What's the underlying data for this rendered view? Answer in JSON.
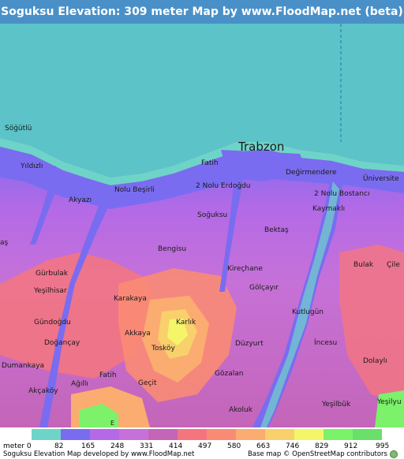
{
  "title": "Soguksu Elevation: 309 meter Map by www.FloodMap.net (beta)",
  "colors": {
    "title_bg": "#4a90c8",
    "sea": "#5cc3c8",
    "shore": "#6fd4c8"
  },
  "place_labels": [
    {
      "id": "sogutlu",
      "text": "Söğütlü"
    },
    {
      "id": "trabzon",
      "text": "Trabzon"
    },
    {
      "id": "fatih-north",
      "text": "Fatih"
    },
    {
      "id": "degirmendere",
      "text": "Değirmendere"
    },
    {
      "id": "yildizli",
      "text": "Yıldızlı"
    },
    {
      "id": "universite",
      "text": "Üniversite"
    },
    {
      "id": "nolu-besirli",
      "text": "Nolu Beşirli"
    },
    {
      "id": "nolu-erdogdu",
      "text": "2 Nolu Erdoğdu"
    },
    {
      "id": "nolu-bostanci",
      "text": "2 Nolu Bostancı"
    },
    {
      "id": "akyazi",
      "text": "Akyazı"
    },
    {
      "id": "kaymakli",
      "text": "Kaymaklı"
    },
    {
      "id": "soguksu",
      "text": "Soğuksu"
    },
    {
      "id": "bektas",
      "text": "Bektaş"
    },
    {
      "id": "as",
      "text": "aş"
    },
    {
      "id": "bengisu",
      "text": "Bengisu"
    },
    {
      "id": "gurbulak",
      "text": "Gürbulak"
    },
    {
      "id": "kirechane",
      "text": "Kireçhane"
    },
    {
      "id": "bulak",
      "text": "Bulak"
    },
    {
      "id": "cile",
      "text": "Çile"
    },
    {
      "id": "yesilhisar",
      "text": "Yeşilhisar"
    },
    {
      "id": "golcayir",
      "text": "Gölçayır"
    },
    {
      "id": "karakaya",
      "text": "Karakaya"
    },
    {
      "id": "kutlugun",
      "text": "Kutlugün"
    },
    {
      "id": "gundogdu",
      "text": "Gündoğdu"
    },
    {
      "id": "karlik",
      "text": "Karlık"
    },
    {
      "id": "akkaya",
      "text": "Akkaya"
    },
    {
      "id": "incesu",
      "text": "İncesu"
    },
    {
      "id": "dogancay",
      "text": "Doğançay"
    },
    {
      "id": "toskoy",
      "text": "Tosköy"
    },
    {
      "id": "duzyurt",
      "text": "Düzyurt"
    },
    {
      "id": "dumankaya",
      "text": "Dumankaya"
    },
    {
      "id": "dolayli",
      "text": "Dolaylı"
    },
    {
      "id": "fatih-south",
      "text": "Fatih"
    },
    {
      "id": "gecit",
      "text": "Geçit"
    },
    {
      "id": "gozalan",
      "text": "Gözalan"
    },
    {
      "id": "akcakoy",
      "text": "Akçaköy"
    },
    {
      "id": "agilli",
      "text": "Ağıllı"
    },
    {
      "id": "yesilbuk",
      "text": "Yeşilbük"
    },
    {
      "id": "yesilyu",
      "text": "Yeşilyu"
    },
    {
      "id": "akoluk",
      "text": "Akoluk"
    },
    {
      "id": "road-e",
      "text": "E"
    }
  ],
  "legend": {
    "unit_label": "meter 0",
    "ticks": [
      "82",
      "165",
      "248",
      "331",
      "414",
      "497",
      "580",
      "663",
      "746",
      "829",
      "912",
      "995"
    ],
    "colors": [
      "#6fd4c8",
      "#7a6cf0",
      "#b46ae6",
      "#c671d8",
      "#c465b8",
      "#f5757e",
      "#f98b74",
      "#fbac70",
      "#f8d06c",
      "#f5f56a",
      "#7cf26a",
      "#6adf6a"
    ]
  },
  "footer": {
    "left": "Soguksu Elevation Map developed by www.FloodMap.net",
    "right": "Base map © OpenStreetMap contributors"
  }
}
